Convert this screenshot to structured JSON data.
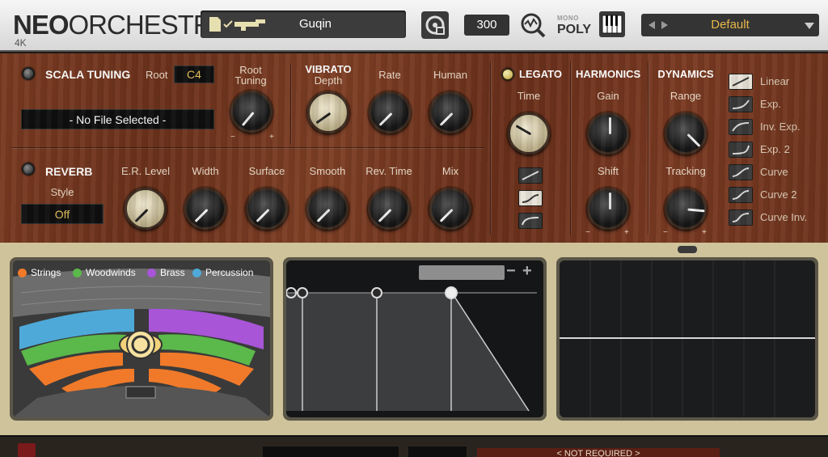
{
  "header": {
    "logo_bold": "NEO",
    "logo_rest": "ORCHESTRA",
    "edition": "4K",
    "instrument": "Guqin",
    "voices": "300",
    "mono_label": "MONO",
    "poly_label": "POLY",
    "preset": "Default"
  },
  "scala": {
    "title": "SCALA TUNING",
    "root_label": "Root",
    "root_value": "C4",
    "root_tuning_label": "Root Tuning",
    "file": "- No File Selected -"
  },
  "vibrato": {
    "title": "VIBRATO",
    "depth": "Depth",
    "rate": "Rate",
    "human": "Human"
  },
  "legato": {
    "title": "LEGATO",
    "time": "Time"
  },
  "harmonics": {
    "title": "HARMONICS",
    "gain": "Gain",
    "shift": "Shift"
  },
  "dynamics": {
    "title": "DYNAMICS",
    "range": "Range",
    "tracking": "Tracking"
  },
  "curves": [
    "Linear",
    "Exp.",
    "Inv. Exp.",
    "Exp. 2",
    "Curve",
    "Curve 2",
    "Curve Inv."
  ],
  "reverb": {
    "title": "REVERB",
    "style_label": "Style",
    "style_value": "Off",
    "er_level": "E.R. Level",
    "width": "Width",
    "surface": "Surface",
    "smooth": "Smooth",
    "rev_time": "Rev. Time",
    "mix": "Mix"
  },
  "stage": {
    "legend": [
      {
        "label": "Strings",
        "color": "#f07a2a"
      },
      {
        "label": "Woodwinds",
        "color": "#5bb84a"
      },
      {
        "label": "Brass",
        "color": "#a855d8"
      },
      {
        "label": "Percussion",
        "color": "#4ea9d8"
      }
    ]
  },
  "envelope": {
    "minus": "−",
    "plus": "+"
  },
  "footer": {
    "status": "< NOT REQUIRED >"
  },
  "colors": {
    "accent": "#e8b84a",
    "wood": "#73381f"
  }
}
